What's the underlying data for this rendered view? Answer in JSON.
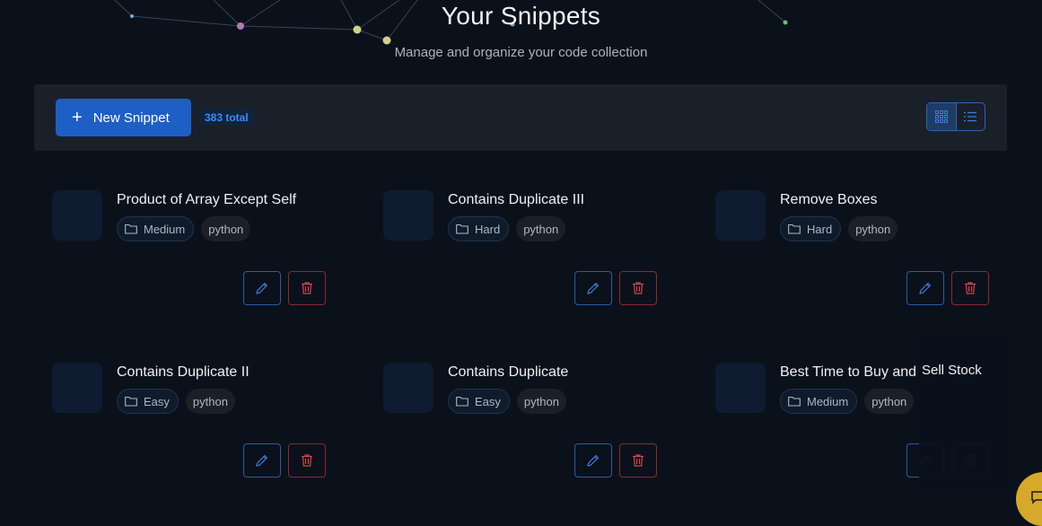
{
  "header": {
    "title": "Your Snippets",
    "subtitle": "Manage and organize your code collection"
  },
  "toolbar": {
    "new_label": "New Snippet",
    "total_label": "383 total",
    "view_modes": [
      "grid",
      "list"
    ],
    "active_view": "grid"
  },
  "snippets": [
    {
      "title": "Product of Array Except Self",
      "difficulty": "Medium",
      "language": "python"
    },
    {
      "title": "Contains Duplicate III",
      "difficulty": "Hard",
      "language": "python"
    },
    {
      "title": "Remove Boxes",
      "difficulty": "Hard",
      "language": "python"
    },
    {
      "title": "Contains Duplicate II",
      "difficulty": "Easy",
      "language": "python"
    },
    {
      "title": "Contains Duplicate",
      "difficulty": "Easy",
      "language": "python"
    },
    {
      "title": "Best Time to Buy and",
      "difficulty": "Medium",
      "language": "python"
    }
  ],
  "tooltip": {
    "text": "Sell Stock"
  },
  "colors": {
    "background": "#0b111b",
    "accent": "#1d5fc4",
    "edit_border": "#2c5aa6",
    "delete_border": "#8a2b2e",
    "chat_button": "#d6a92a"
  },
  "icons": {
    "new": "plus-icon",
    "grid": "grid-icon",
    "list": "list-icon",
    "tag": "folder-icon",
    "edit": "pencil-icon",
    "delete": "trash-icon",
    "chat": "chat-bubble-icon"
  }
}
